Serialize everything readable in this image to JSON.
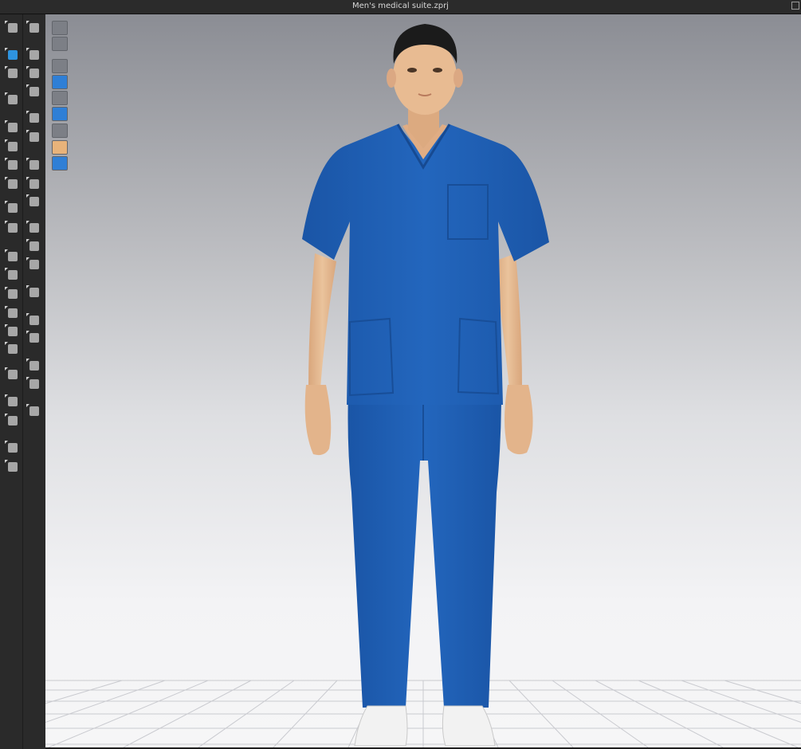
{
  "window": {
    "title": "Men's medical suite.zprj"
  },
  "toolbar": {
    "left_tools": [
      "select-move-icon",
      "transform-icon",
      "edit-pattern-icon",
      "shirt-icon",
      "rotate-icon",
      "segment-icon",
      "tuck-icon",
      "image-icon",
      "line-icon",
      "fold-icon",
      "export-icon",
      "bag-icon",
      "gift-icon",
      "book-icon",
      "hand-icon",
      "avatar-icon",
      "ruler-icon",
      "needle-icon",
      "pen-icon",
      "garment-front-icon",
      "garment-back-icon"
    ],
    "right_tools": [
      "run-pose-icon",
      "pin-icon",
      "sewing-icon",
      "tack-icon",
      "cut-icon",
      "zip-icon",
      "trim-icon",
      "seam-icon",
      "pattern-icon",
      "button-icon",
      "buttonhole-icon",
      "lock-button-icon",
      "ribbon-icon",
      "fill-icon",
      "fill2-icon",
      "fill3-icon",
      "fill4-icon",
      "arrow-expand-icon"
    ]
  },
  "viewport_tools": [
    "measure-icon",
    "shirt-outline-icon",
    "shirt-view-icon",
    "texture-icon",
    "avatar-view-icon",
    "layer-icon",
    "shape-icon",
    "skin-icon",
    "globe-icon"
  ],
  "colors": {
    "scrubs": "#1f5fb3",
    "skin": "#e5b58d",
    "hair": "#1b1b1b",
    "shoes": "#f2f2f2",
    "viewport_top": "#8b8d94",
    "viewport_bottom": "#f6f6f7"
  }
}
